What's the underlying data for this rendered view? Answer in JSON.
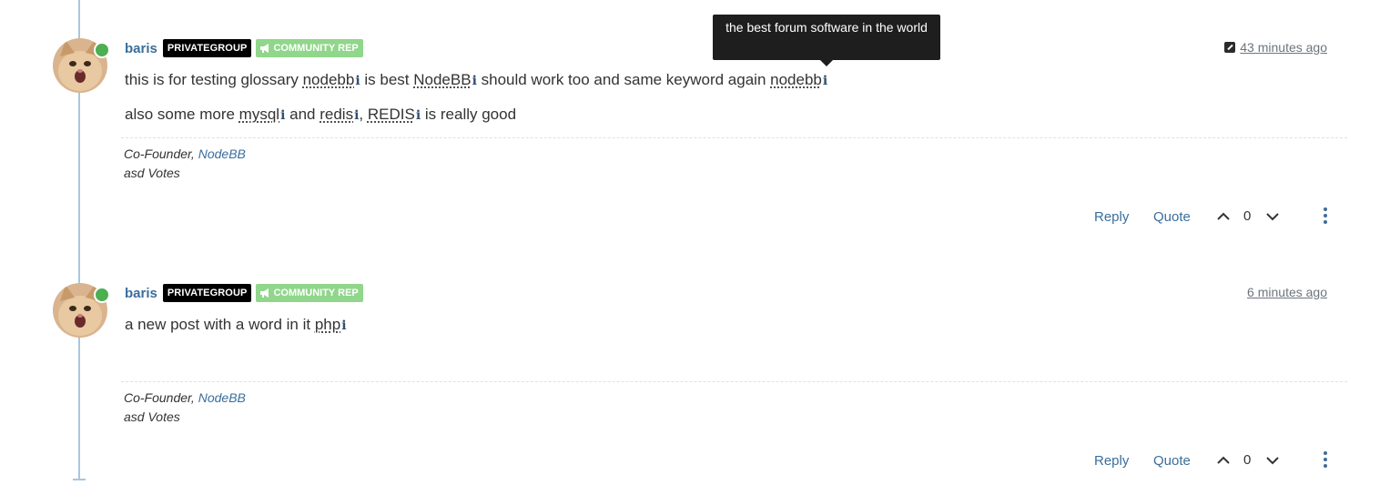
{
  "tooltip": {
    "text": "the best forum software in the world"
  },
  "posts": [
    {
      "username": "baris",
      "group_badge": "PRIVATEGROUP",
      "rep_badge": "COMMUNITY REP",
      "timestamp": "43 minutes ago",
      "edited": true,
      "lines": [
        [
          "this is for testing glossary ",
          {
            "term": "nodebb"
          },
          " is best ",
          {
            "term": "NodeBB"
          },
          " should work too and same keyword again ",
          {
            "term": "nodebb"
          },
          ""
        ],
        [
          "also some more ",
          {
            "term": "mysql"
          },
          " and ",
          {
            "term": "redis"
          },
          ", ",
          {
            "term": "REDIS"
          },
          " is really good"
        ]
      ],
      "signature": {
        "title": "Co-Founder, ",
        "link": "NodeBB",
        "line2": "asd Votes"
      },
      "actions": {
        "reply": "Reply",
        "quote": "Quote",
        "votes": "0"
      }
    },
    {
      "username": "baris",
      "group_badge": "PRIVATEGROUP",
      "rep_badge": "COMMUNITY REP",
      "timestamp": "6 minutes ago",
      "edited": false,
      "lines": [
        [
          "a new post with a word in it ",
          {
            "term": "php"
          },
          ""
        ]
      ],
      "signature": {
        "title": "Co-Founder, ",
        "link": "NodeBB",
        "line2": "asd Votes"
      },
      "actions": {
        "reply": "Reply",
        "quote": "Quote",
        "votes": "0"
      }
    }
  ],
  "icons": {
    "online": "online-status-icon",
    "megaphone": "megaphone-icon",
    "edit": "edit-icon",
    "info": "info-icon",
    "upvote": "chevron-up-icon",
    "downvote": "chevron-down-icon",
    "more": "kebab-menu-icon"
  },
  "colors": {
    "link": "#3a6e9c",
    "online": "#4caf50",
    "rep_badge": "#90d68b",
    "group_badge": "#000000",
    "timeline": "#a8c6e0"
  }
}
